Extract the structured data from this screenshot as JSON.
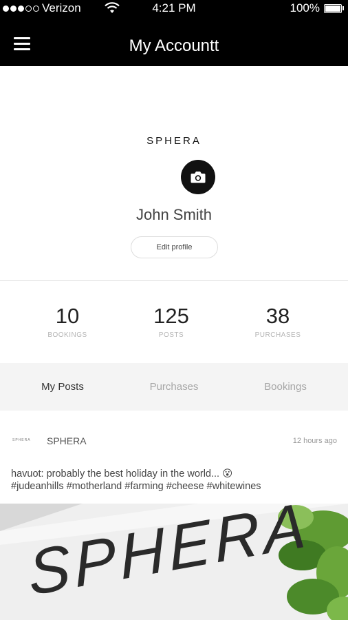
{
  "status_bar": {
    "carrier": "Verizon",
    "time": "4:21 PM",
    "battery": "100%",
    "signal_bars_filled": 3,
    "signal_bars_total": 5
  },
  "nav": {
    "title": "My Accountt",
    "menu_icon": "hamburger-menu-icon"
  },
  "profile": {
    "brand": "SPHERA",
    "camera_icon": "camera-icon",
    "name": "John Smith",
    "edit_label": "Edit profile"
  },
  "stats": [
    {
      "value": "10",
      "label": "BOOKINGS"
    },
    {
      "value": "125",
      "label": "POSTS"
    },
    {
      "value": "38",
      "label": "PURCHASES"
    }
  ],
  "tabs": [
    {
      "label": "My Posts",
      "active": true
    },
    {
      "label": "Purchases",
      "active": false
    },
    {
      "label": "Bookings",
      "active": false
    }
  ],
  "post": {
    "avatar_text": "SPHERA",
    "author": "SPHERA",
    "time": "12 hours ago",
    "caption_line1": "havuot: probably the best holiday in the world... 😮",
    "caption_line2": "#judeanhills #motherland #farming #cheese #whitewines",
    "image_text": "SPHERA"
  },
  "colors": {
    "bar_background": "#000000",
    "tab_background": "#f4f4f4",
    "muted_text": "#a6a6a6"
  }
}
